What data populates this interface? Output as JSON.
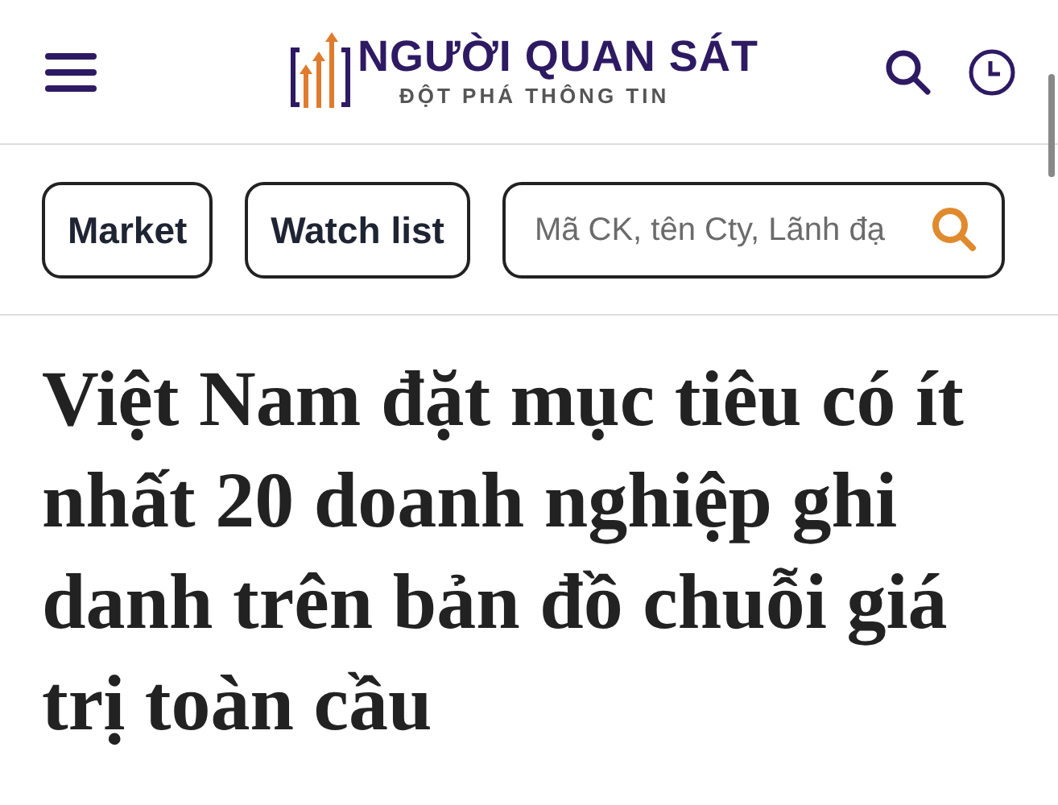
{
  "header": {
    "logo_title": "NGƯỜI QUAN SÁT",
    "logo_tagline": "ĐỘT PHÁ THÔNG TIN"
  },
  "nav_buttons": [
    "Market",
    "Watch list"
  ],
  "search": {
    "placeholder": "Mã CK, tên Cty, Lãnh đạ"
  },
  "article": {
    "headline": "Việt Nam đặt mục tiêu có ít nhất 20 doanh nghiệp ghi danh trên bản đồ chuỗi giá trị toàn cầu"
  }
}
